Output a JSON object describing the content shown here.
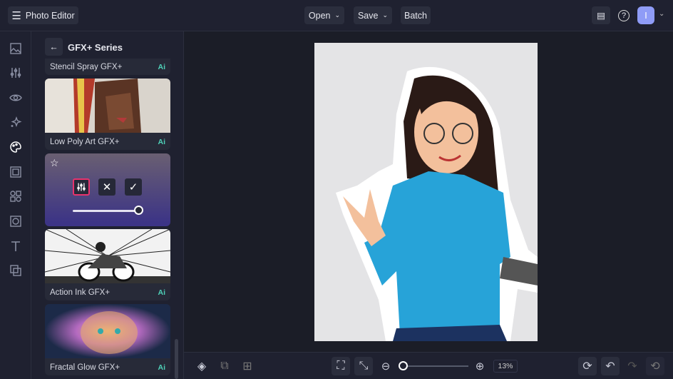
{
  "header": {
    "title": "Photo Editor",
    "open_label": "Open",
    "save_label": "Save",
    "batch_label": "Batch",
    "avatar_initial": "I"
  },
  "panel": {
    "title": "GFX+ Series",
    "ai_badge": "Ai",
    "items": [
      {
        "label": "Stencil Spray GFX+"
      },
      {
        "label": "Low Poly Art GFX+"
      },
      {
        "label": "Action Ink GFX+"
      },
      {
        "label": "Fractal Glow GFX+"
      }
    ],
    "intensity": 1.0
  },
  "footer": {
    "zoom": "13%",
    "zoom_slider": 0.03
  },
  "colors": {
    "accent": "#e8336d",
    "avatar": "#8f9cf7",
    "ai": "#4fd1b8"
  }
}
